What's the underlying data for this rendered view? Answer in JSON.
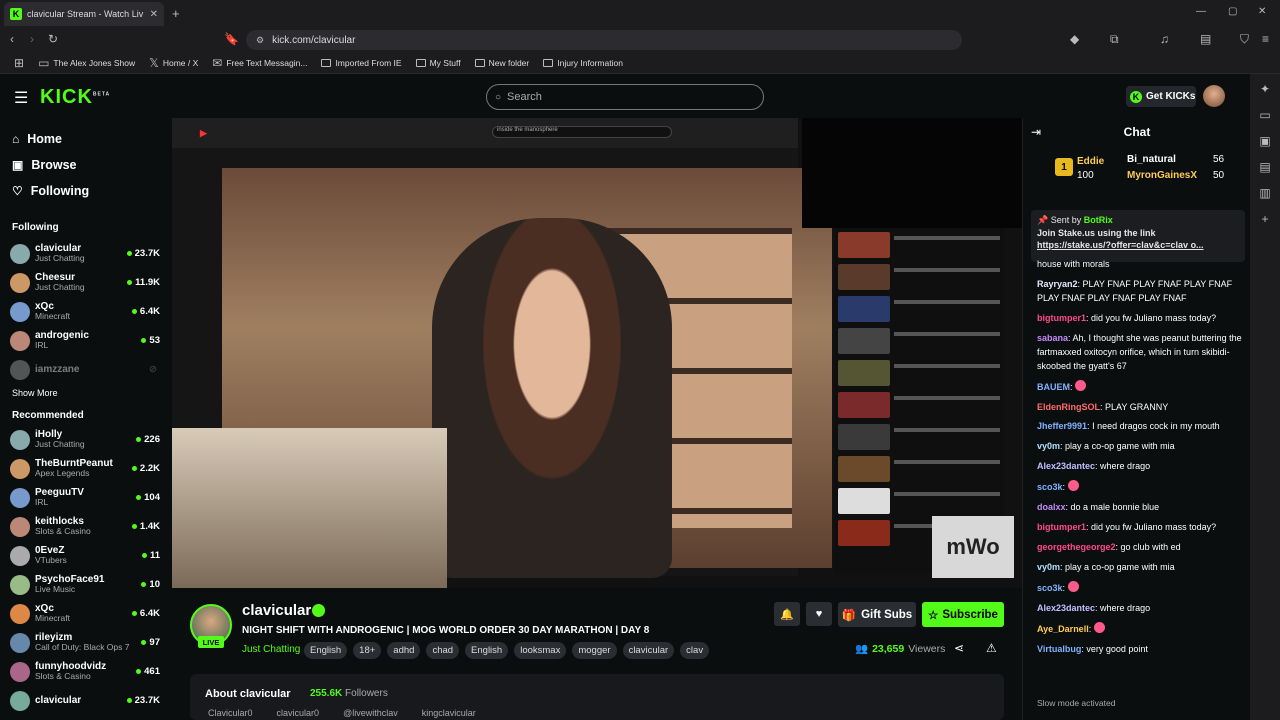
{
  "browser": {
    "tab_title": "clavicular Stream - Watch Liv",
    "url": "kick.com/clavicular",
    "bookmarks": [
      "The Alex Jones Show",
      "Home / X",
      "Free Text Messagin...",
      "Imported From IE",
      "My Stuff",
      "New folder",
      "Injury Information"
    ]
  },
  "header": {
    "logo": "KICK",
    "logo_badge": "BETA",
    "search_placeholder": "Search",
    "get_kicks": "Get KICKs"
  },
  "sidebar": {
    "nav": [
      "Home",
      "Browse",
      "Following"
    ],
    "following_heading": "Following",
    "following": [
      {
        "name": "clavicular",
        "category": "Just Chatting",
        "viewers": "23.7K",
        "live": true
      },
      {
        "name": "Cheesur",
        "category": "Just Chatting",
        "viewers": "11.9K",
        "live": true
      },
      {
        "name": "xQc",
        "category": "Minecraft",
        "viewers": "6.4K",
        "live": true
      },
      {
        "name": "androgenic",
        "category": "IRL",
        "viewers": "53",
        "live": true
      },
      {
        "name": "iamzzane",
        "category": "",
        "viewers": "",
        "live": false
      }
    ],
    "show_more": "Show More",
    "recommended_heading": "Recommended",
    "recommended": [
      {
        "name": "iHolly",
        "category": "Just Chatting",
        "viewers": "226"
      },
      {
        "name": "TheBurntPeanut",
        "category": "Apex Legends",
        "viewers": "2.2K"
      },
      {
        "name": "PeeguuTV",
        "category": "IRL",
        "viewers": "104"
      },
      {
        "name": "keithlocks",
        "category": "Slots & Casino",
        "viewers": "1.4K"
      },
      {
        "name": "0EveZ",
        "category": "VTubers",
        "viewers": "11"
      },
      {
        "name": "PsychoFace91",
        "category": "Live Music",
        "viewers": "10"
      },
      {
        "name": "xQc",
        "category": "Minecraft",
        "viewers": "6.4K"
      },
      {
        "name": "rileyizm",
        "category": "Call of Duty: Black Ops 7",
        "viewers": "97"
      },
      {
        "name": "funnyhoodvidz",
        "category": "Slots & Casino",
        "viewers": "461"
      },
      {
        "name": "clavicular",
        "category": "",
        "viewers": "23.7K"
      }
    ]
  },
  "video": {
    "yt_search": "inside the manosphere",
    "overlay_logo": "mWo"
  },
  "stream": {
    "streamer": "clavicular",
    "live_badge": "LIVE",
    "title": "NIGHT SHIFT WITH ANDROGENIC | MOG WORLD ORDER 30 DAY MARATHON | DAY 8",
    "category": "Just Chatting",
    "tags": [
      "English",
      "18+",
      "adhd",
      "chad",
      "English",
      "looksmax",
      "mogger",
      "clavicular",
      "clav"
    ],
    "gift_subs": "Gift Subs",
    "subscribe": "Subscribe",
    "viewers": "23,659",
    "viewers_label": "Viewers",
    "about_title": "About clavicular",
    "followers": "255.6K",
    "followers_label": "Followers",
    "socials": [
      "Clavicular0",
      "clavicular0",
      "@livewithclav",
      "kingclavicular"
    ]
  },
  "chat": {
    "heading": "Chat",
    "leaderboard": [
      {
        "rank": "1",
        "name": "Eddie",
        "amount": "100"
      },
      {
        "name": "Bi_natural",
        "amount": "56"
      },
      {
        "name": "MyronGainesX",
        "amount": "50"
      }
    ],
    "pinned_by_label": "Sent by",
    "pinned_by": "BotRix",
    "pinned_text": "Join Stake.us using the link",
    "pinned_link": "https://stake.us/?offer=clav&c=clav o...",
    "partial_msg": "house with morals",
    "messages": [
      {
        "user": "Rayryan2",
        "color": "#e8e8ff",
        "text": "PLAY FNAF  PLAY FNAF  PLAY FNAF  PLAY FNAF  PLAY FNAF  PLAY FNAF"
      },
      {
        "user": "bigtumper1",
        "color": "#ff4a8a",
        "text": "did you fw Juliano mass today?"
      },
      {
        "user": "sabana",
        "color": "#c58af9",
        "text": "Ah, I thought she was peanut buttering the fartmaxxed oxitocyn orifice, which in turn skibidi-skoobed the gyatt's 67"
      },
      {
        "user": "BAUEM",
        "color": "#7fb2ff",
        "text": ""
      },
      {
        "user": "EldenRingSOL",
        "color": "#ff6a6a",
        "text": "PLAY GRANNY"
      },
      {
        "user": "Jheffer9991",
        "color": "#7fb2ff",
        "text": "I need dragos cock in my mouth"
      },
      {
        "user": "vy0m",
        "color": "#b0e0ff",
        "text": "play a co-op game with mia"
      },
      {
        "user": "Alex23dantec",
        "color": "#c0c0ff",
        "text": "where drago"
      },
      {
        "user": "sco3k",
        "color": "#7fb2ff",
        "text": ""
      },
      {
        "user": "doalxx",
        "color": "#c58af9",
        "text": "do a male bonnie blue"
      },
      {
        "user": "bigtumper1",
        "color": "#ff4a8a",
        "text": "did you fw Juliano mass today?"
      },
      {
        "user": "georgethegeorge2",
        "color": "#ff4a8a",
        "text": "go club with ed"
      },
      {
        "user": "vy0m",
        "color": "#b0e0ff",
        "text": "play a co-op game with mia"
      },
      {
        "user": "sco3k",
        "color": "#7fb2ff",
        "text": ""
      },
      {
        "user": "Alex23dantec",
        "color": "#c0c0ff",
        "text": "where drago"
      },
      {
        "user": "Aye_Darnell",
        "color": "#ffcc55",
        "text": ""
      },
      {
        "user": "Virtualbug",
        "color": "#7fb2ff",
        "text": "very good point"
      }
    ],
    "slow_mode": "Slow mode activated"
  },
  "colors": {
    "brand": "#53fc18",
    "background": "#0b0e0f"
  }
}
